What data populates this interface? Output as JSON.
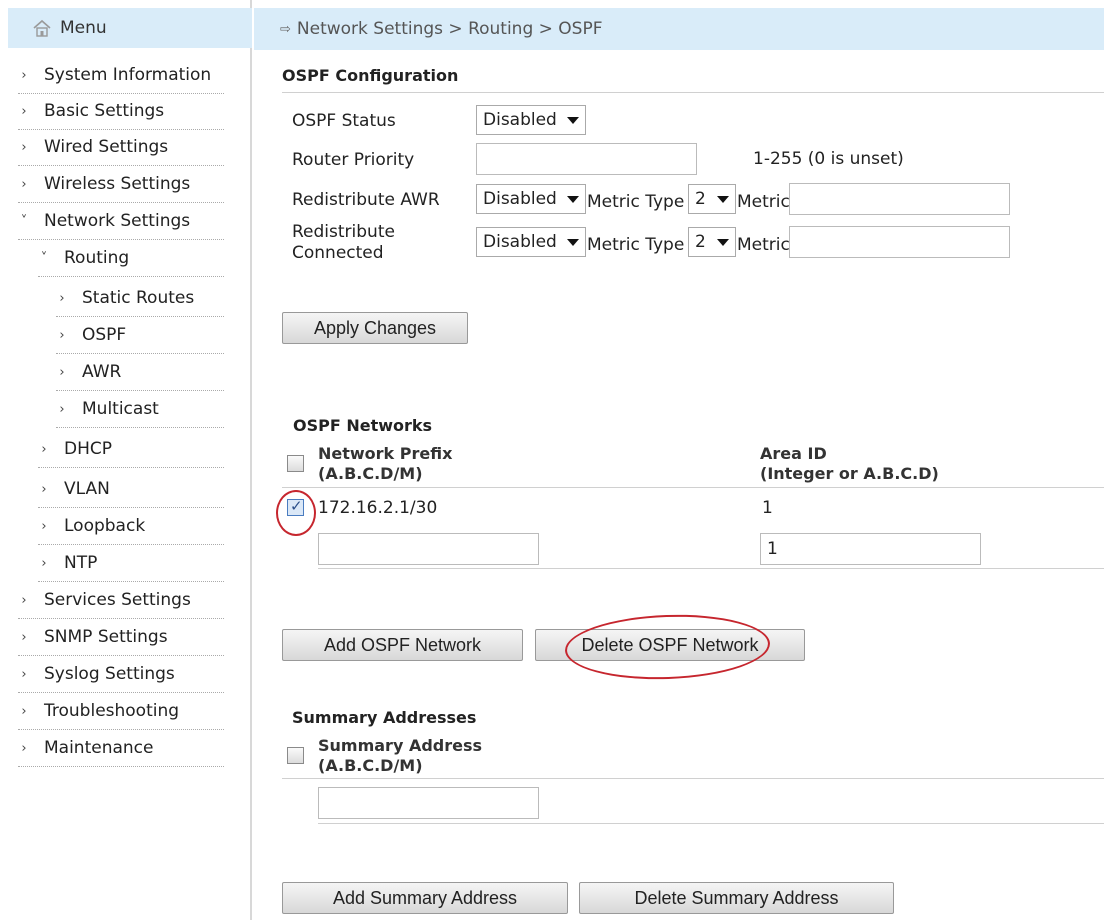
{
  "sidebar": {
    "menu_label": "Menu",
    "items": [
      {
        "label": "System Information",
        "chev": "›"
      },
      {
        "label": "Basic Settings",
        "chev": "›"
      },
      {
        "label": "Wired Settings",
        "chev": "›"
      },
      {
        "label": "Wireless Settings",
        "chev": "›"
      },
      {
        "label": "Network Settings",
        "chev": "˅"
      },
      {
        "label": "Routing",
        "chev": "˅"
      },
      {
        "label": "Static Routes",
        "chev": "›"
      },
      {
        "label": "OSPF",
        "chev": "›"
      },
      {
        "label": "AWR",
        "chev": "›"
      },
      {
        "label": "Multicast",
        "chev": "›"
      },
      {
        "label": "DHCP",
        "chev": "›"
      },
      {
        "label": "VLAN",
        "chev": "›"
      },
      {
        "label": "Loopback",
        "chev": "›"
      },
      {
        "label": "NTP",
        "chev": "›"
      },
      {
        "label": "Services Settings",
        "chev": "›"
      },
      {
        "label": "SNMP Settings",
        "chev": "›"
      },
      {
        "label": "Syslog Settings",
        "chev": "›"
      },
      {
        "label": "Troubleshooting",
        "chev": "›"
      },
      {
        "label": "Maintenance",
        "chev": "›"
      }
    ]
  },
  "breadcrumb": "Network Settings > Routing > OSPF",
  "config": {
    "title": "OSPF Configuration",
    "status_label": "OSPF Status",
    "status_value": "Disabled",
    "priority_label": "Router Priority",
    "priority_value": "",
    "priority_hint": "1-255 (0 is unset)",
    "redist_awr_label": "Redistribute AWR",
    "redist_connected_line1": "Redistribute",
    "redist_connected_line2": "Connected",
    "redist_awr_value": "Disabled",
    "redist_connected_value": "Disabled",
    "metric_type_label": "Metric Type",
    "metric_type_awr": "2",
    "metric_type_connected": "2",
    "metric_label": "Metric",
    "apply_button": "Apply Changes"
  },
  "networks": {
    "title": "OSPF Networks",
    "col_prefix_1": "Network Prefix",
    "col_prefix_2": "(A.B.C.D/M)",
    "col_area_1": "Area ID",
    "col_area_2": "(Integer or A.B.C.D)",
    "rows": [
      {
        "prefix": "172.16.2.1/30",
        "area": "1",
        "checked": true
      }
    ],
    "new_prefix_value": "",
    "new_area_value": "1",
    "add_button": "Add OSPF Network",
    "delete_button": "Delete OSPF Network"
  },
  "summary": {
    "title": "Summary Addresses",
    "col_1": "Summary Address",
    "col_2": "(A.B.C.D/M)",
    "new_value": "",
    "add_button": "Add Summary Address",
    "delete_button": "Delete Summary Address"
  },
  "colors": {
    "header_bg": "#d9ecf9",
    "highlight_ring": "#c6262e"
  }
}
